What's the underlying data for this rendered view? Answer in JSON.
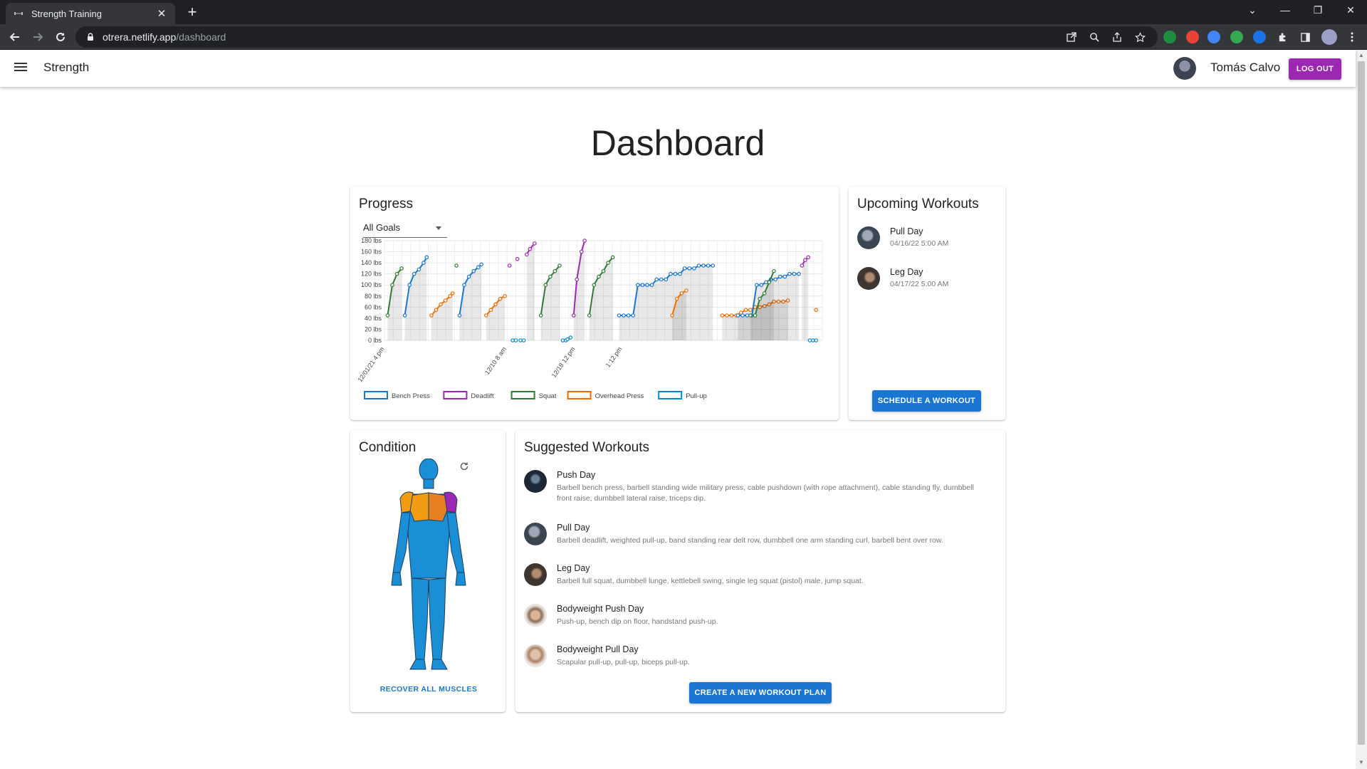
{
  "browser": {
    "tab_title": "Strength Training",
    "url_host": "otrera.netlify.app",
    "url_path": "/dashboard"
  },
  "appbar": {
    "title": "Strength",
    "user_name": "Tomás Calvo",
    "logout_label": "LOG OUT"
  },
  "page": {
    "title": "Dashboard"
  },
  "progress": {
    "title": "Progress",
    "filter_value": "All Goals"
  },
  "chart_data": {
    "type": "line",
    "ylim": [
      0,
      180
    ],
    "y_ticks": [
      "0 lbs",
      "20 lbs",
      "40 lbs",
      "60 lbs",
      "80 lbs",
      "100 lbs",
      "120 lbs",
      "140 lbs",
      "160 lbs",
      "180 lbs"
    ],
    "x_tick_labels": [
      "12/01/21 4 pm",
      "12/10 8 am",
      "12/18 12 pm",
      "1:12 pm"
    ],
    "legend": [
      "Bench Press",
      "Deadlift",
      "Squat",
      "Overhead Press",
      "Pull-up"
    ],
    "colors": {
      "Bench Press": "#1976d2",
      "Deadlift": "#9c27b0",
      "Squat": "#2e7d32",
      "Overhead Press": "#ef6c00",
      "Pull-up": "#0288d1"
    },
    "series": [
      {
        "name": "Squat",
        "points": [
          [
            1.0,
            45
          ],
          [
            2.5,
            100
          ],
          [
            4.0,
            120
          ],
          [
            5.5,
            130
          ]
        ]
      },
      {
        "name": "Bench Press",
        "points": [
          [
            6.5,
            45
          ],
          [
            8.0,
            100
          ],
          [
            9.5,
            120
          ],
          [
            11.0,
            128
          ],
          [
            12.5,
            140
          ],
          [
            13.5,
            150
          ]
        ]
      },
      {
        "name": "Overhead Press",
        "points": [
          [
            15.0,
            45
          ],
          [
            16.5,
            55
          ],
          [
            18.0,
            65
          ],
          [
            19.5,
            72
          ],
          [
            21.0,
            80
          ],
          [
            21.8,
            85
          ]
        ]
      },
      {
        "name": "Squat",
        "points": [
          [
            23.0,
            135
          ]
        ]
      },
      {
        "name": "Bench Press",
        "points": [
          [
            24.0,
            45
          ],
          [
            25.5,
            100
          ],
          [
            27.0,
            115
          ],
          [
            28.5,
            125
          ],
          [
            30.0,
            132
          ],
          [
            31.0,
            137
          ]
        ]
      },
      {
        "name": "Overhead Press",
        "points": [
          [
            32.5,
            45
          ],
          [
            34.0,
            55
          ],
          [
            35.5,
            65
          ],
          [
            37.0,
            75
          ],
          [
            38.5,
            80
          ]
        ]
      },
      {
        "name": "Deadlift",
        "points": [
          [
            40.0,
            135
          ]
        ]
      },
      {
        "name": "Deadlift",
        "points": [
          [
            42.5,
            147
          ]
        ]
      },
      {
        "name": "Pull-up",
        "points": [
          [
            41.0,
            0
          ],
          [
            42.0,
            0
          ]
        ]
      },
      {
        "name": "Pull-up",
        "points": [
          [
            43.5,
            0
          ],
          [
            44.5,
            0
          ]
        ]
      },
      {
        "name": "Deadlift",
        "points": [
          [
            45.5,
            155
          ],
          [
            46.5,
            165
          ],
          [
            48.0,
            175
          ]
        ]
      },
      {
        "name": "Squat",
        "points": [
          [
            50.0,
            45
          ],
          [
            51.5,
            100
          ],
          [
            53.0,
            115
          ],
          [
            54.5,
            125
          ],
          [
            56.0,
            135
          ]
        ]
      },
      {
        "name": "Pull-up",
        "points": [
          [
            57.0,
            0
          ],
          [
            58.0,
            0
          ],
          [
            58.5,
            2
          ],
          [
            59.5,
            5
          ]
        ]
      },
      {
        "name": "Deadlift",
        "points": [
          [
            60.5,
            45
          ],
          [
            61.5,
            110
          ],
          [
            63.0,
            160
          ],
          [
            64.0,
            180
          ]
        ]
      },
      {
        "name": "Squat",
        "points": [
          [
            65.5,
            45
          ],
          [
            67.0,
            100
          ],
          [
            68.5,
            115
          ],
          [
            70.0,
            125
          ],
          [
            71.5,
            140
          ],
          [
            73.0,
            150
          ]
        ]
      },
      {
        "name": "Bench Press",
        "points": [
          [
            75.0,
            45
          ],
          [
            76.5,
            45
          ],
          [
            78.0,
            45
          ],
          [
            79.5,
            45
          ],
          [
            81.0,
            100
          ],
          [
            82.5,
            100
          ],
          [
            84.0,
            100
          ],
          [
            85.5,
            100
          ],
          [
            87.0,
            110
          ],
          [
            88.5,
            110
          ],
          [
            90.0,
            110
          ],
          [
            91.5,
            120
          ],
          [
            93.0,
            120
          ],
          [
            94.5,
            120
          ],
          [
            96.0,
            130
          ],
          [
            97.5,
            130
          ],
          [
            99.0,
            130
          ],
          [
            100.5,
            135
          ],
          [
            102.0,
            135
          ],
          [
            103.5,
            135
          ],
          [
            105.0,
            135
          ]
        ]
      },
      {
        "name": "Overhead Press",
        "points": [
          [
            92.0,
            45
          ],
          [
            93.5,
            75
          ],
          [
            95.0,
            85
          ],
          [
            96.5,
            90
          ]
        ]
      },
      {
        "name": "Overhead Press",
        "points": [
          [
            108.0,
            45
          ],
          [
            109.5,
            45
          ],
          [
            111.0,
            45
          ],
          [
            112.5,
            45
          ],
          [
            114.0,
            50
          ],
          [
            115.5,
            55
          ],
          [
            117.0,
            55
          ],
          [
            118.5,
            60
          ],
          [
            120.0,
            60
          ],
          [
            121.5,
            62
          ],
          [
            123.0,
            65
          ],
          [
            124.5,
            70
          ],
          [
            126.0,
            70
          ],
          [
            127.5,
            70
          ],
          [
            129.0,
            72
          ]
        ]
      },
      {
        "name": "Bench Press",
        "points": [
          [
            113.0,
            45
          ],
          [
            114.5,
            45
          ],
          [
            116.0,
            45
          ],
          [
            117.5,
            45
          ],
          [
            119.0,
            100
          ],
          [
            120.5,
            100
          ],
          [
            122.0,
            105
          ],
          [
            123.5,
            110
          ],
          [
            125.0,
            110
          ],
          [
            126.5,
            115
          ],
          [
            128.0,
            115
          ],
          [
            129.5,
            120
          ],
          [
            131.0,
            120
          ],
          [
            132.5,
            120
          ]
        ]
      },
      {
        "name": "Squat",
        "points": [
          [
            117.0,
            45
          ],
          [
            118.5,
            45
          ],
          [
            120.0,
            75
          ],
          [
            121.5,
            85
          ],
          [
            123.0,
            105
          ],
          [
            124.5,
            125
          ]
        ]
      },
      {
        "name": "Deadlift",
        "points": [
          [
            133.5,
            135
          ],
          [
            134.5,
            145
          ],
          [
            135.5,
            150
          ]
        ]
      },
      {
        "name": "Overhead Press",
        "points": [
          [
            138.0,
            55
          ]
        ]
      },
      {
        "name": "Pull-up",
        "points": [
          [
            136.0,
            0
          ],
          [
            137.0,
            0
          ],
          [
            138.0,
            0
          ]
        ]
      }
    ]
  },
  "upcoming": {
    "title": "Upcoming Workouts",
    "items": [
      {
        "name": "Pull Day",
        "date": "04/16/22 5:00 AM"
      },
      {
        "name": "Leg Day",
        "date": "04/17/22 5:00 AM"
      }
    ],
    "schedule_label": "SCHEDULE A WORKOUT"
  },
  "condition": {
    "title": "Condition",
    "recover_label": "RECOVER ALL MUSCLES"
  },
  "suggested": {
    "title": "Suggested Workouts",
    "items": [
      {
        "name": "Push Day",
        "desc": "Barbell bench press, barbell standing wide military press, cable pushdown (with rope attachment), cable standing fly, dumbbell front raise, dumbbell lateral raise, triceps dip."
      },
      {
        "name": "Pull Day",
        "desc": "Barbell deadlift, weighted pull-up, band standing rear delt row, dumbbell one arm standing curl, barbell bent over row."
      },
      {
        "name": "Leg Day",
        "desc": "Barbell full squat, dumbbell lunge, kettlebell swing, single leg squat (pistol) male, jump squat."
      },
      {
        "name": "Bodyweight Push Day",
        "desc": "Push-up, bench dip on floor, handstand push-up."
      },
      {
        "name": "Bodyweight Pull Day",
        "desc": "Scapular pull-up, pull-up, biceps pull-up."
      }
    ],
    "create_label": "CREATE A NEW WORKOUT PLAN"
  }
}
